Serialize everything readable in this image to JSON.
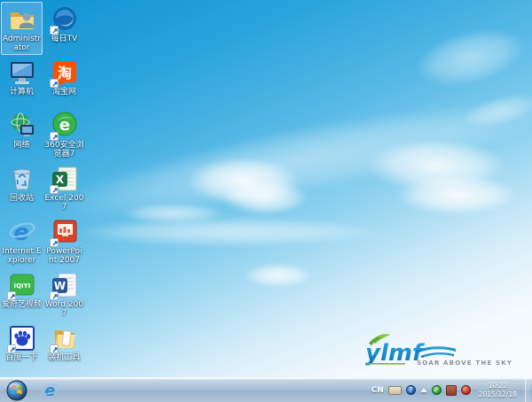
{
  "desktop": {
    "wallpaper": {
      "sky_top": "#0e92d2",
      "sky_mid": "#8ed2ef",
      "sky_bottom": "#f8fcfe"
    },
    "icons": [
      {
        "label": "Administrator",
        "selected": true
      },
      {
        "label": "每日TV",
        "selected": false
      },
      {
        "label": "计算机",
        "selected": false
      },
      {
        "label": "淘宝网",
        "selected": false
      },
      {
        "label": "网络",
        "selected": false
      },
      {
        "label": "360安全浏览器7",
        "selected": false
      },
      {
        "label": "回收站",
        "selected": false
      },
      {
        "label": "Excel 2007",
        "selected": false
      },
      {
        "label": "Internet Explorer",
        "selected": false
      },
      {
        "label": "PowerPoint 2007",
        "selected": false
      },
      {
        "label": "爱奇艺视频",
        "selected": false
      },
      {
        "label": "Word 2007",
        "selected": false
      },
      {
        "label": "百度一下",
        "selected": false
      },
      {
        "label": "装机工具",
        "selected": false
      }
    ],
    "icon_glyphs": {
      "taobao": "淘",
      "browser360": "e",
      "excel": "X",
      "ie": "e",
      "iqiyi": "iQIYI",
      "word": "W"
    },
    "logo": {
      "text": "ylmf",
      "tagline": "SOAR ABOVE THE SKY"
    }
  },
  "taskbar": {
    "tray": {
      "language": "CN",
      "time": "10:22",
      "date": "2015/12/18"
    }
  }
}
